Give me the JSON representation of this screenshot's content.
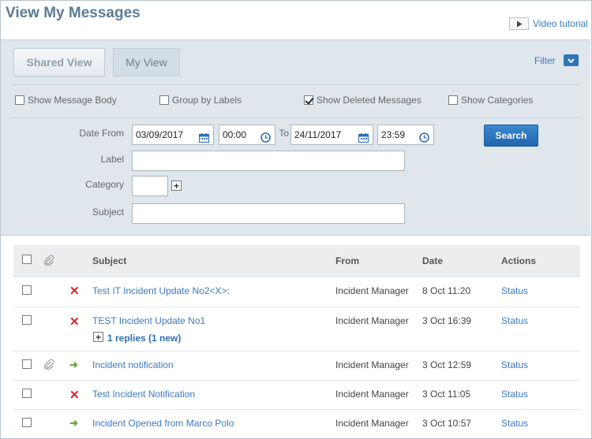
{
  "page": {
    "title": "View My Messages",
    "video_tutorial": "Video tutorial"
  },
  "views": {
    "shared": "Shared View",
    "my": "My View"
  },
  "filter": {
    "toggle_label": "Filter",
    "options": [
      {
        "label": "Show Message Body",
        "checked": false
      },
      {
        "label": "Group by Labels",
        "checked": false
      },
      {
        "label": "Show Deleted Messages",
        "checked": true
      },
      {
        "label": "Show Categories",
        "checked": false
      }
    ],
    "date_from_label": "Date From",
    "date_from": "03/09/2017",
    "time_from": "00:00",
    "to_label": "To",
    "date_to": "24/11/2017",
    "time_to": "23:59",
    "label_label": "Label",
    "label_value": "",
    "category_label": "Category",
    "category_value": "",
    "subject_label": "Subject",
    "subject_value": "",
    "search_button": "Search"
  },
  "table": {
    "headers": {
      "subject": "Subject",
      "from": "From",
      "date": "Date",
      "actions": "Actions"
    },
    "rows": [
      {
        "status": "deleted",
        "attachment": false,
        "subject": "Test IT Incident Update No2<X>:",
        "from": "Incident Manager",
        "date": "8 Oct 11:20",
        "action": "Status"
      },
      {
        "status": "deleted",
        "attachment": false,
        "subject": "TEST Incident Update No1",
        "replies": "1 replies (1 new)",
        "from": "Incident Manager",
        "date": "3 Oct 16:39",
        "action": "Status"
      },
      {
        "status": "forwarded",
        "attachment": true,
        "subject": "Incident notification",
        "from": "Incident Manager",
        "date": "3 Oct 12:59",
        "action": "Status"
      },
      {
        "status": "deleted",
        "attachment": false,
        "subject": "Test Incident Notification",
        "from": "Incident Manager",
        "date": "3 Oct 11:05",
        "action": "Status"
      },
      {
        "status": "forwarded",
        "attachment": false,
        "subject": "Incident Opened from Marco Polo",
        "from": "Incident Manager",
        "date": "3 Oct 10:57",
        "action": "Status"
      }
    ]
  }
}
